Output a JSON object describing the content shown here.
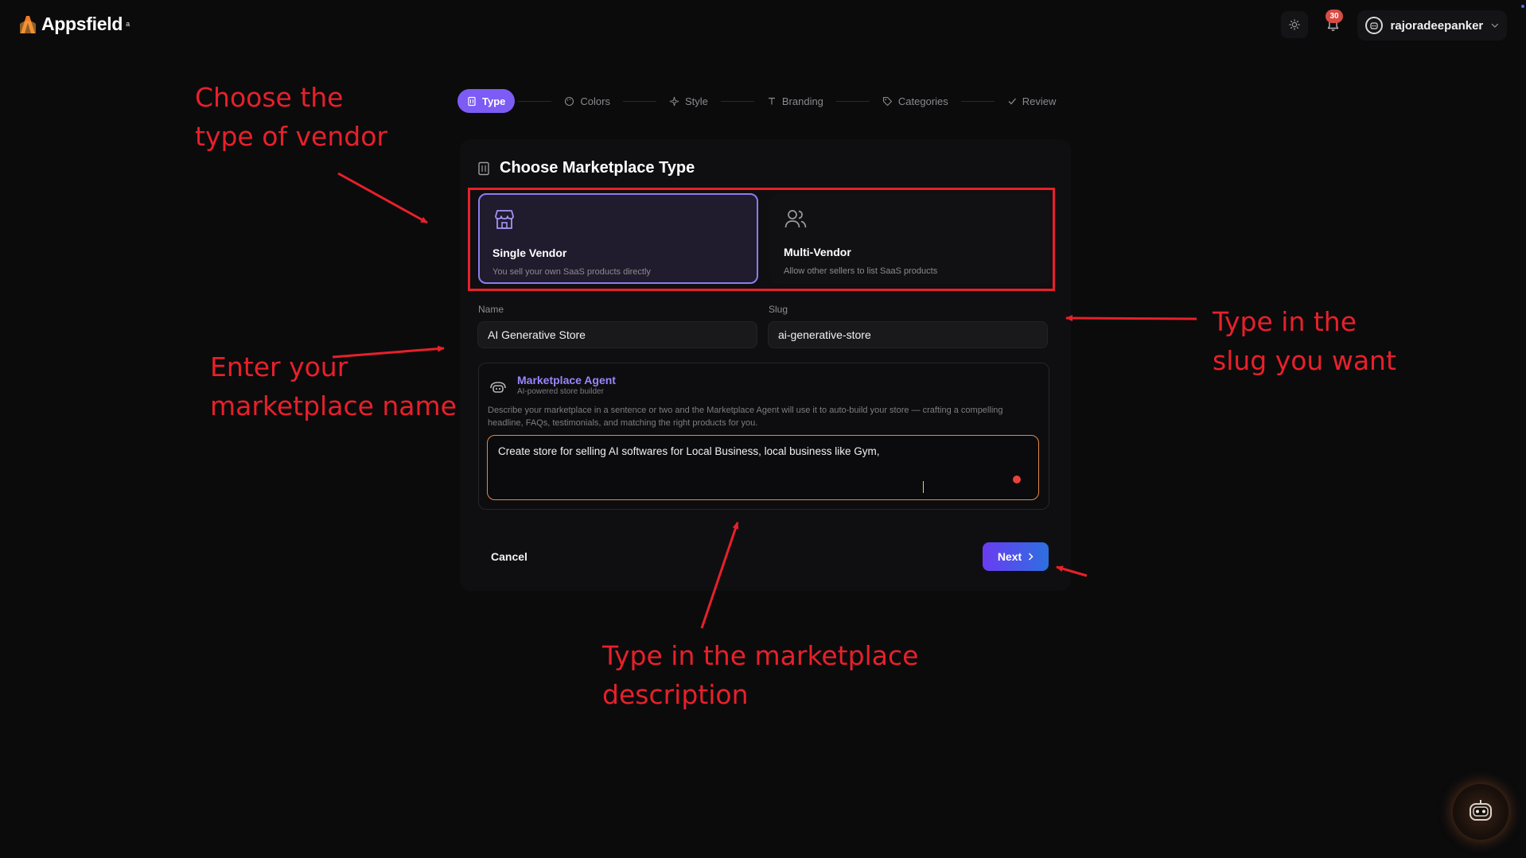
{
  "app": {
    "brand": "Appsfield",
    "brand_mark": "a"
  },
  "header": {
    "notification_count": "30",
    "username": "rajoradeepanker"
  },
  "stepper": {
    "steps": [
      {
        "label": "Type",
        "icon": "building-icon",
        "active": true
      },
      {
        "label": "Colors",
        "icon": "palette-icon",
        "active": false
      },
      {
        "label": "Style",
        "icon": "sparkle-icon",
        "active": false
      },
      {
        "label": "Branding",
        "icon": "type-icon",
        "active": false
      },
      {
        "label": "Categories",
        "icon": "tag-icon",
        "active": false
      },
      {
        "label": "Review",
        "icon": "check-icon",
        "active": false
      }
    ]
  },
  "form": {
    "title": "Choose Marketplace Type",
    "options": [
      {
        "title": "Single Vendor",
        "desc": "You sell your own SaaS products directly",
        "icon": "store-icon",
        "selected": true
      },
      {
        "title": "Multi-Vendor",
        "desc": "Allow other sellers to list SaaS products",
        "icon": "users-icon",
        "selected": false
      }
    ],
    "name_label": "Name",
    "name_value": "AI Generative Store",
    "slug_label": "Slug",
    "slug_value": "ai-generative-store",
    "agent": {
      "title": "Marketplace Agent",
      "subtitle": "AI-powered store builder",
      "description": "Describe your marketplace in a sentence or two and the Marketplace Agent will use it to auto-build your store — crafting a compelling headline, FAQs, testimonials, and matching the right products for you.",
      "input_value": "Create store for selling AI softwares for Local Business, local business like Gym,"
    },
    "cancel_label": "Cancel",
    "next_label": "Next"
  },
  "annotations": {
    "type": "Choose the\ntype of vendor",
    "name": "Enter your\nmarketplace name",
    "slug": "Type in the\nslug you want",
    "description": "Type in the marketplace\ndescription"
  },
  "colors": {
    "accent": "#7c5cf5",
    "annotation": "#e8202a",
    "background": "#0b0b0c"
  }
}
